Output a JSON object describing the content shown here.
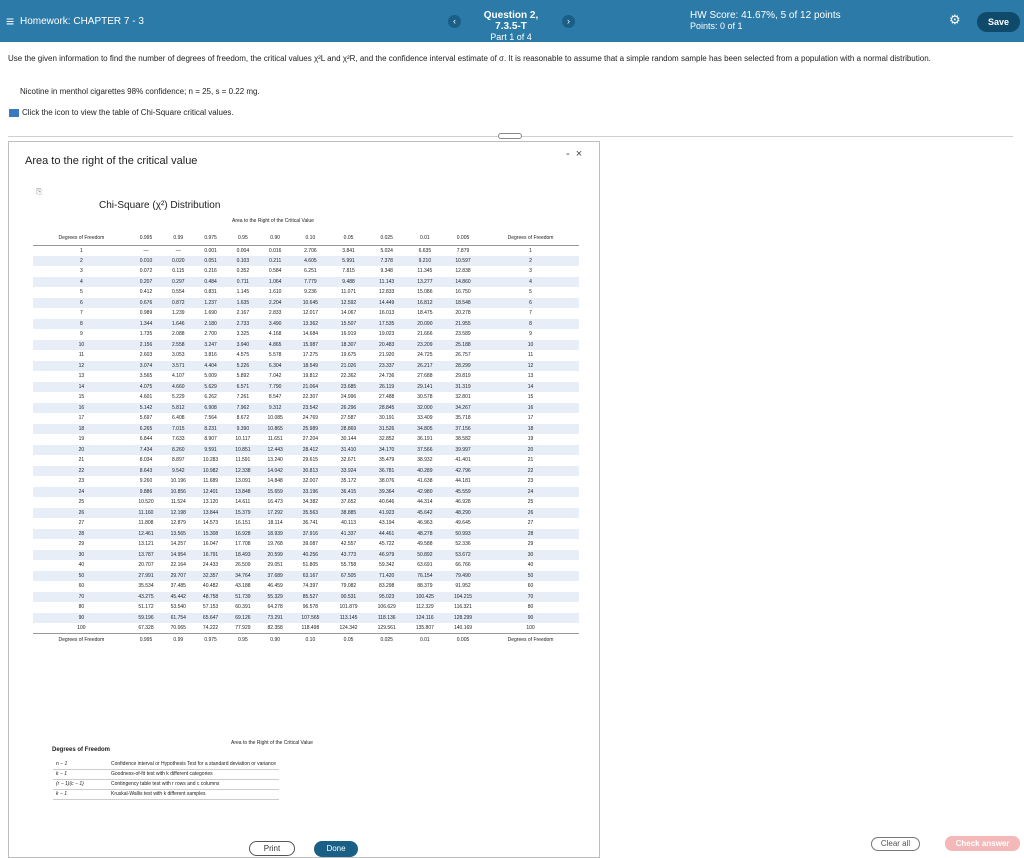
{
  "header": {
    "menu_icon": "menu-icon",
    "homework_label": "Homework: CHAPTER 7 - 3",
    "question_title": "Question 2, 7.3.5-T",
    "question_part": "Part 1 of 4",
    "hw_score": "HW Score: 41.67%, 5 of 12 points",
    "points": "Points: 0 of 1",
    "save_label": "Save",
    "prev_glyph": "‹",
    "next_glyph": "›",
    "gear_glyph": "⚙",
    "colors": {
      "bar": "#2b7aa8",
      "save": "#0f4a6b"
    }
  },
  "question": {
    "text": "Use the given information to find the number of degrees of freedom, the critical values χ²L and χ²R, and the confidence interval estimate of σ. It is reasonable to assume that a simple random sample has been selected from a population with a normal distribution.",
    "given": "Nicotine in menthol cigarettes 98% confidence; n = 25, s = 0.22 mg.",
    "icon_line": "Click the icon to view the table of Chi-Square critical values."
  },
  "modal": {
    "title": "Area to the right of the critical value",
    "minimize_glyph": "-",
    "close_glyph": "×",
    "chart_title": "Chi-Square (χ²) Distribution",
    "area_label": "Area to the Right of the Critical Value",
    "df_label": "Degrees of Freedom",
    "columns": [
      "0.995",
      "0.99",
      "0.975",
      "0.95",
      "0.90",
      "0.10",
      "0.05",
      "0.025",
      "0.01",
      "0.005"
    ],
    "rows": [
      [
        "1",
        "—",
        "—",
        "0.001",
        "0.004",
        "0.016",
        "2.706",
        "3.841",
        "5.024",
        "6.635",
        "7.879"
      ],
      [
        "2",
        "0.010",
        "0.020",
        "0.051",
        "0.103",
        "0.211",
        "4.605",
        "5.991",
        "7.378",
        "9.210",
        "10.597"
      ],
      [
        "3",
        "0.072",
        "0.115",
        "0.216",
        "0.352",
        "0.584",
        "6.251",
        "7.815",
        "9.348",
        "11.345",
        "12.838"
      ],
      [
        "4",
        "0.207",
        "0.297",
        "0.484",
        "0.711",
        "1.064",
        "7.779",
        "9.488",
        "11.143",
        "13.277",
        "14.860"
      ],
      [
        "5",
        "0.412",
        "0.554",
        "0.831",
        "1.145",
        "1.610",
        "9.236",
        "11.071",
        "12.833",
        "15.086",
        "16.750"
      ],
      [
        "6",
        "0.676",
        "0.872",
        "1.237",
        "1.635",
        "2.204",
        "10.645",
        "12.592",
        "14.449",
        "16.812",
        "18.548"
      ],
      [
        "7",
        "0.989",
        "1.239",
        "1.690",
        "2.167",
        "2.833",
        "12.017",
        "14.067",
        "16.013",
        "18.475",
        "20.278"
      ],
      [
        "8",
        "1.344",
        "1.646",
        "2.180",
        "2.733",
        "3.490",
        "13.362",
        "15.507",
        "17.535",
        "20.090",
        "21.955"
      ],
      [
        "9",
        "1.735",
        "2.088",
        "2.700",
        "3.325",
        "4.168",
        "14.684",
        "16.919",
        "19.023",
        "21.666",
        "23.589"
      ],
      [
        "10",
        "2.156",
        "2.558",
        "3.247",
        "3.940",
        "4.865",
        "15.987",
        "18.307",
        "20.483",
        "23.209",
        "25.188"
      ],
      [
        "11",
        "2.603",
        "3.053",
        "3.816",
        "4.575",
        "5.578",
        "17.275",
        "19.675",
        "21.920",
        "24.725",
        "26.757"
      ],
      [
        "12",
        "3.074",
        "3.571",
        "4.404",
        "5.226",
        "6.304",
        "18.549",
        "21.026",
        "23.337",
        "26.217",
        "28.299"
      ],
      [
        "13",
        "3.565",
        "4.107",
        "5.009",
        "5.892",
        "7.042",
        "19.812",
        "22.362",
        "24.736",
        "27.688",
        "29.819"
      ],
      [
        "14",
        "4.075",
        "4.660",
        "5.629",
        "6.571",
        "7.790",
        "21.064",
        "23.685",
        "26.119",
        "29.141",
        "31.319"
      ],
      [
        "15",
        "4.601",
        "5.229",
        "6.262",
        "7.261",
        "8.547",
        "22.307",
        "24.996",
        "27.488",
        "30.578",
        "32.801"
      ],
      [
        "16",
        "5.142",
        "5.812",
        "6.908",
        "7.962",
        "9.312",
        "23.542",
        "26.296",
        "28.845",
        "32.000",
        "34.267"
      ],
      [
        "17",
        "5.697",
        "6.408",
        "7.564",
        "8.672",
        "10.085",
        "24.769",
        "27.587",
        "30.191",
        "33.409",
        "35.718"
      ],
      [
        "18",
        "6.265",
        "7.015",
        "8.231",
        "9.390",
        "10.865",
        "25.989",
        "28.869",
        "31.526",
        "34.805",
        "37.156"
      ],
      [
        "19",
        "6.844",
        "7.633",
        "8.907",
        "10.117",
        "11.651",
        "27.204",
        "30.144",
        "32.852",
        "36.191",
        "38.582"
      ],
      [
        "20",
        "7.434",
        "8.260",
        "9.591",
        "10.851",
        "12.443",
        "28.412",
        "31.410",
        "34.170",
        "37.566",
        "39.997"
      ],
      [
        "21",
        "8.034",
        "8.897",
        "10.283",
        "11.591",
        "13.240",
        "29.615",
        "32.671",
        "35.479",
        "38.932",
        "41.401"
      ],
      [
        "22",
        "8.643",
        "9.542",
        "10.982",
        "12.338",
        "14.042",
        "30.813",
        "33.924",
        "36.781",
        "40.289",
        "42.796"
      ],
      [
        "23",
        "9.260",
        "10.196",
        "11.689",
        "13.091",
        "14.848",
        "32.007",
        "35.172",
        "38.076",
        "41.638",
        "44.181"
      ],
      [
        "24",
        "9.886",
        "10.856",
        "12.401",
        "13.848",
        "15.659",
        "33.196",
        "36.415",
        "39.364",
        "42.980",
        "45.559"
      ],
      [
        "25",
        "10.520",
        "11.524",
        "13.120",
        "14.611",
        "16.473",
        "34.382",
        "37.652",
        "40.646",
        "44.314",
        "46.928"
      ],
      [
        "26",
        "11.160",
        "12.198",
        "13.844",
        "15.379",
        "17.292",
        "35.563",
        "38.885",
        "41.923",
        "45.642",
        "48.290"
      ],
      [
        "27",
        "11.808",
        "12.879",
        "14.573",
        "16.151",
        "18.114",
        "36.741",
        "40.113",
        "43.194",
        "46.963",
        "49.645"
      ],
      [
        "28",
        "12.461",
        "13.565",
        "15.308",
        "16.928",
        "18.939",
        "37.916",
        "41.337",
        "44.461",
        "48.278",
        "50.993"
      ],
      [
        "29",
        "13.121",
        "14.257",
        "16.047",
        "17.708",
        "19.768",
        "39.087",
        "42.557",
        "45.722",
        "49.588",
        "52.336"
      ],
      [
        "30",
        "13.787",
        "14.954",
        "16.791",
        "18.493",
        "20.599",
        "40.256",
        "43.773",
        "46.979",
        "50.892",
        "53.672"
      ],
      [
        "40",
        "20.707",
        "22.164",
        "24.433",
        "26.509",
        "29.051",
        "51.805",
        "55.758",
        "59.342",
        "63.691",
        "66.766"
      ],
      [
        "50",
        "27.991",
        "29.707",
        "32.357",
        "34.764",
        "37.689",
        "63.167",
        "67.505",
        "71.420",
        "76.154",
        "79.490"
      ],
      [
        "60",
        "35.534",
        "37.485",
        "40.482",
        "43.188",
        "46.459",
        "74.397",
        "79.082",
        "83.298",
        "88.379",
        "91.952"
      ],
      [
        "70",
        "43.275",
        "45.442",
        "48.758",
        "51.739",
        "55.329",
        "85.527",
        "90.531",
        "95.023",
        "100.425",
        "104.215"
      ],
      [
        "80",
        "51.172",
        "53.540",
        "57.153",
        "60.391",
        "64.278",
        "96.578",
        "101.879",
        "106.629",
        "112.329",
        "116.321"
      ],
      [
        "90",
        "59.196",
        "61.754",
        "65.647",
        "69.126",
        "73.291",
        "107.565",
        "113.145",
        "118.136",
        "124.116",
        "128.299"
      ],
      [
        "100",
        "67.328",
        "70.065",
        "74.222",
        "77.929",
        "82.358",
        "118.498",
        "124.342",
        "129.561",
        "135.807",
        "140.169"
      ]
    ],
    "df_section_title": "Degrees of Freedom",
    "df_notes": [
      {
        "k": "n − 1",
        "text": "Confidence interval or Hypothesis Test for a standard deviation or variance"
      },
      {
        "k": "k − 1",
        "text": "Goodness-of-fit test with k different categories"
      },
      {
        "k": "(r − 1)(c − 1)",
        "text": "Contingency table test with r rows and c columns"
      },
      {
        "k": "k − 1",
        "text": "Kruskal-Wallis test with k different samples"
      }
    ],
    "print_label": "Print",
    "done_label": "Done"
  },
  "footer": {
    "clear_all": "Clear all",
    "check_answer": "Check answer"
  }
}
